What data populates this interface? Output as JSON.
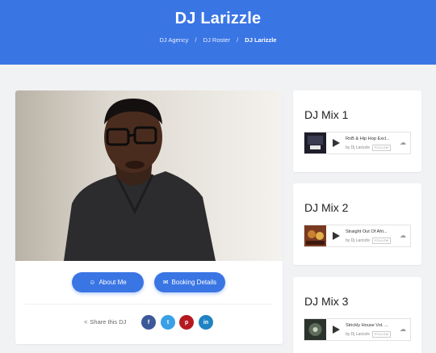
{
  "header": {
    "title": "DJ Larizzle",
    "breadcrumb": [
      "DJ Agency",
      "DJ Roster",
      "DJ Larizzle"
    ],
    "separator": "/"
  },
  "profile": {
    "about_label": "About Me",
    "booking_label": "Booking Details",
    "share_label": "Share this DJ",
    "social": [
      "f",
      "t",
      "p",
      "in"
    ]
  },
  "mixes": [
    {
      "title": "DJ Mix 1",
      "track": "RnB & Hip Hop Excl...",
      "artist": "by Dj Larizzle",
      "follow": "FOLLOW"
    },
    {
      "title": "DJ Mix 2",
      "track": "Straight Out Of Afri...",
      "artist": "by Dj Larizzle",
      "follow": "FOLLOW"
    },
    {
      "title": "DJ Mix 3",
      "track": "Strickly House Vol. ...",
      "artist": "by Dj Larizzle",
      "follow": "FOLLOW"
    }
  ],
  "colors": {
    "accent": "#3a75e4",
    "facebook": "#3b5998",
    "twitter": "#3aa0e6",
    "pinterest": "#b5191f",
    "linkedin": "#1f83c1"
  }
}
